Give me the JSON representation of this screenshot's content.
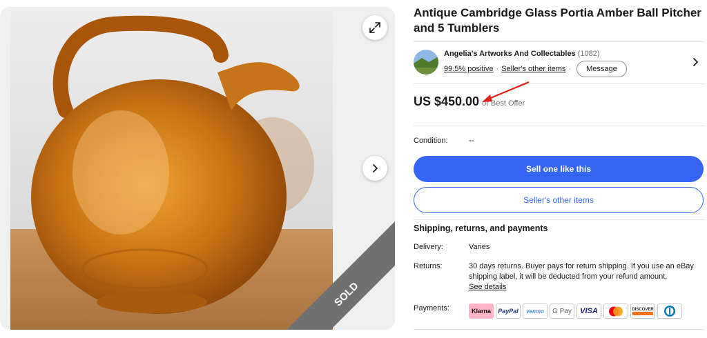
{
  "listing": {
    "title": "Antique Cambridge Glass Portia Amber Ball Pitcher and 5 Tumblers",
    "sold_badge": "SOLD"
  },
  "gallery": {
    "expand_icon": "expand-icon",
    "next_icon": "chevron-right-icon"
  },
  "seller": {
    "name": "Angelia's Artworks And Collectables",
    "feedback_count": "(1082)",
    "positive": "99.5% positive",
    "other_items_link": "Seller's other items",
    "message_button": "Message"
  },
  "price": {
    "amount": "US $450.00",
    "best_offer": "or Best Offer"
  },
  "condition": {
    "label": "Condition:",
    "value": "--"
  },
  "actions": {
    "primary": "Sell one like this",
    "secondary": "Seller's other items"
  },
  "shipping": {
    "heading": "Shipping, returns, and payments",
    "delivery_label": "Delivery:",
    "delivery_value": "Varies",
    "returns_label": "Returns:",
    "returns_value": "30 days returns. Buyer pays for return shipping. If you use an eBay shipping label, it will be deducted from your refund amount.",
    "see_details": "See details",
    "payments_label": "Payments:",
    "payment_methods": {
      "klarna": "Klarna",
      "paypal": "PayPal",
      "venmo": "venmo",
      "gpay": "G Pay",
      "visa": "VISA",
      "discover": "DISCOVER"
    }
  },
  "colors": {
    "accent": "#3665f3",
    "annotation_arrow": "#e0201b",
    "amber": "#b8650f"
  }
}
